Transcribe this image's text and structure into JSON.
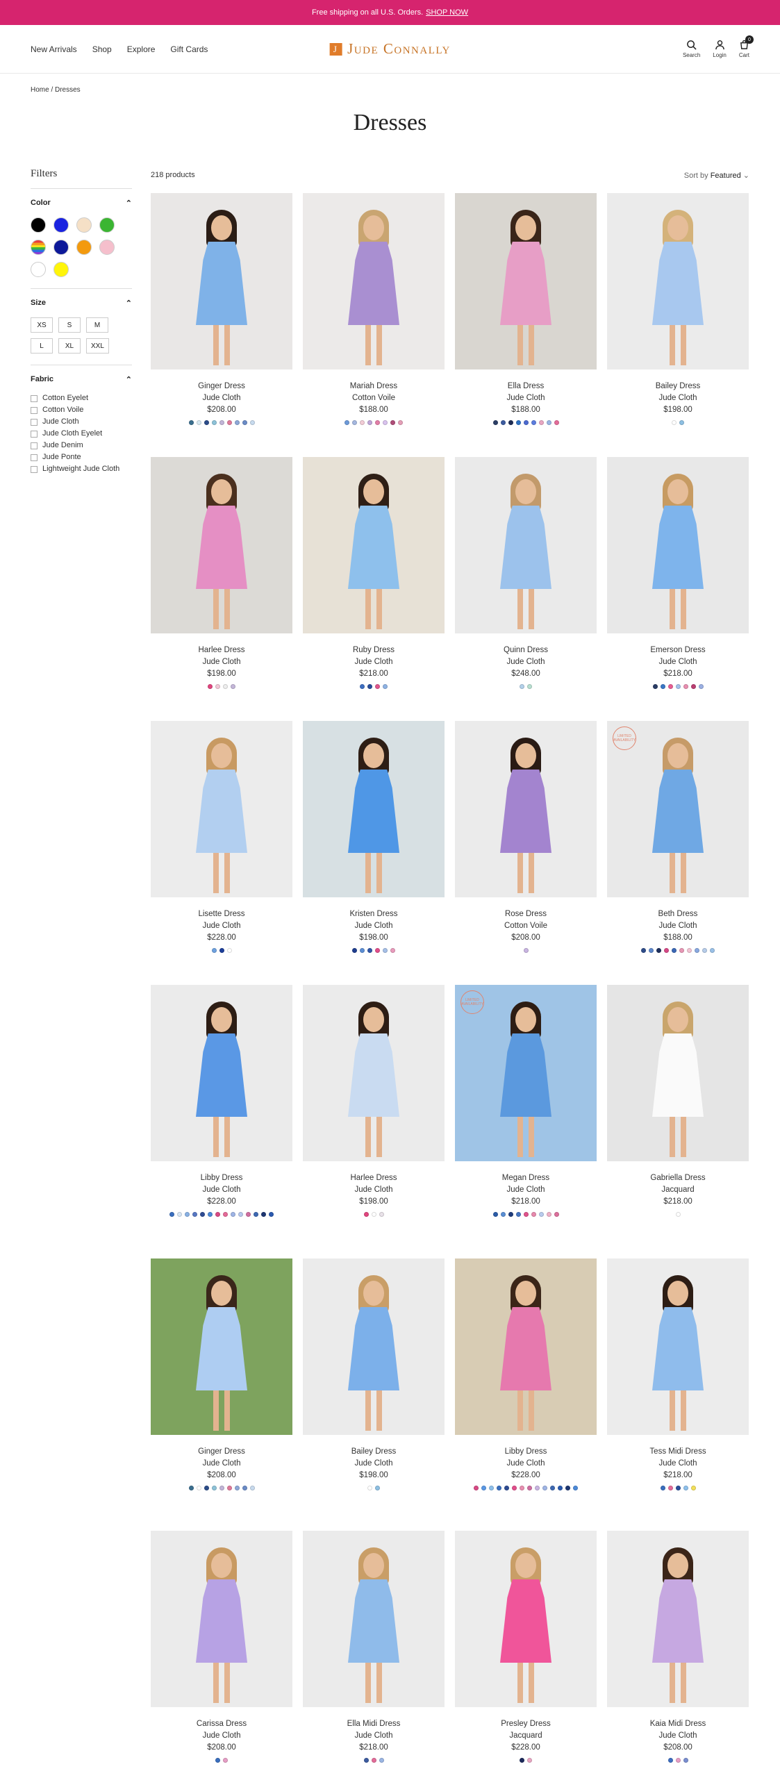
{
  "promo": {
    "text": "Free shipping on all U.S. Orders.",
    "link": "SHOP NOW"
  },
  "nav": [
    "New Arrivals",
    "Shop",
    "Explore",
    "Gift Cards"
  ],
  "logo": "Jude Connally",
  "header_icons": {
    "search": "Search",
    "login": "Login",
    "cart": "Cart",
    "cart_count": "0"
  },
  "breadcrumb": "Home / Dresses",
  "page_title": "Dresses",
  "filters": {
    "title": "Filters",
    "color_label": "Color",
    "colors": [
      "#000000",
      "#1a23e0",
      "#f5e0c6",
      "#3bb532",
      "rainbow",
      "#0d1999",
      "#f39a0e",
      "#f5bfcc",
      "#ffffff",
      "#fff50a"
    ],
    "size_label": "Size",
    "sizes": [
      "XS",
      "S",
      "M",
      "L",
      "XL",
      "XXL"
    ],
    "fabric_label": "Fabric",
    "fabrics": [
      "Cotton Eyelet",
      "Cotton Voile",
      "Jude Cloth",
      "Jude Cloth Eyelet",
      "Jude Denim",
      "Jude Ponte",
      "Lightweight Jude Cloth"
    ]
  },
  "product_count": "218 products",
  "sort": {
    "label": "Sort by",
    "value": "Featured"
  },
  "products": [
    {
      "name": "Ginger Dress",
      "fabric": "Jude Cloth",
      "price": "$208.00",
      "bg": "#e9e7e6",
      "dress": "#7fb2e8",
      "hair": "#2b1d15",
      "swatches": [
        "#3b6f8f",
        "#d9eaf2",
        "#2c4d8a",
        "#8ec3d9",
        "#c2b5d8",
        "#e07a9a",
        "#8ea8d8",
        "#6b8cc7",
        "#c8dbef"
      ]
    },
    {
      "name": "Mariah Dress",
      "fabric": "Cotton Voile",
      "price": "$188.00",
      "bg": "#eceae9",
      "dress": "#a98fd1",
      "hair": "#c9a571",
      "swatches": [
        "#6d9ad9",
        "#a5b8e0",
        "#f2ccd6",
        "#bfa6d9",
        "#e37fa8",
        "#d9c3ef",
        "#b04e79",
        "#e59fb8"
      ]
    },
    {
      "name": "Ella Dress",
      "fabric": "Jude Cloth",
      "price": "$188.00",
      "bg": "#d9d6d0",
      "dress": "#e79ec6",
      "hair": "#3a2519",
      "swatches": [
        "#2b3f66",
        "#3d5ca0",
        "#1f2d55",
        "#2f72c4",
        "#4c6ad1",
        "#5d7ee0",
        "#e9a7c3",
        "#9bb6e4",
        "#e46d9a"
      ]
    },
    {
      "name": "Bailey Dress",
      "fabric": "Jude Cloth",
      "price": "$198.00",
      "bg": "#ebebeb",
      "dress": "#a8c8ef",
      "hair": "#d4b27a",
      "swatches": [
        "#ffffff",
        "#8ec0e3"
      ]
    },
    {
      "name": "Harlee Dress",
      "fabric": "Jude Cloth",
      "price": "$198.00",
      "bg": "#dcdad6",
      "dress": "#e58fc4",
      "hair": "#4a2f1e",
      "swatches": [
        "#e2467f",
        "#f2c9d8",
        "#eeeeee",
        "#c4b7d9"
      ]
    },
    {
      "name": "Ruby Dress",
      "fabric": "Jude Cloth",
      "price": "$218.00",
      "bg": "#e7e1d6",
      "dress": "#8ec0ec",
      "hair": "#2f1f16",
      "swatches": [
        "#3e6fc2",
        "#2a4f9a",
        "#e1588e",
        "#8fb3e4"
      ]
    },
    {
      "name": "Quinn Dress",
      "fabric": "Jude Cloth",
      "price": "$248.00",
      "bg": "#eaeaea",
      "dress": "#9cc2ec",
      "hair": "#c29a6b",
      "swatches": [
        "#b3d1ea",
        "#b8e0d1"
      ]
    },
    {
      "name": "Emerson Dress",
      "fabric": "Jude Cloth",
      "price": "$218.00",
      "bg": "#e8e8e8",
      "dress": "#7eb4ec",
      "hair": "#c79b62",
      "swatches": [
        "#2a3d66",
        "#3a78c7",
        "#e85e93",
        "#a5c1ea",
        "#e98fb1",
        "#bb3f72",
        "#9bb0e3"
      ]
    },
    {
      "name": "Lisette Dress",
      "fabric": "Jude Cloth",
      "price": "$228.00",
      "bg": "#ececec",
      "dress": "#b2cff0",
      "hair": "#c89a62",
      "swatches": [
        "#6fa2e0",
        "#1d3f9a",
        "#ffffff"
      ]
    },
    {
      "name": "Kristen Dress",
      "fabric": "Jude Cloth",
      "price": "$198.00",
      "bg": "#d7e0e3",
      "dress": "#4f97e6",
      "hair": "#2e1e15",
      "swatches": [
        "#1f3e8f",
        "#5d8fd5",
        "#3158a8",
        "#e24e8b",
        "#a6c0e8",
        "#e99cbd"
      ]
    },
    {
      "name": "Rose Dress",
      "fabric": "Cotton Voile",
      "price": "$208.00",
      "bg": "#ebebeb",
      "dress": "#a384cf",
      "hair": "#2a1b14",
      "swatches": [
        "#c9b5e2"
      ]
    },
    {
      "name": "Beth Dress",
      "fabric": "Jude Cloth",
      "price": "$188.00",
      "bg": "#e9e9e9",
      "dress": "#6fa8e4",
      "hair": "#c69b68",
      "tag": "LIMITED AVAILABILITY",
      "swatches": [
        "#2f4d8a",
        "#5e88cc",
        "#1e305e",
        "#d64986",
        "#3b68b6",
        "#e898b6",
        "#f2c4d4",
        "#89a9e0",
        "#b7cdea",
        "#9ac1e8"
      ]
    },
    {
      "name": "Libby Dress",
      "fabric": "Jude Cloth",
      "price": "$228.00",
      "bg": "#ebebeb",
      "dress": "#5a98e5",
      "hair": "#2d1d14",
      "swatches": [
        "#3a6fbf",
        "#d8e6f4",
        "#89b1e4",
        "#5778c4",
        "#2e4c94",
        "#4c8ad9",
        "#d94a85",
        "#e56a98",
        "#9fb5e6",
        "#b8c9ee",
        "#d06fa1",
        "#3e69b3",
        "#1d3672",
        "#2a5ab0"
      ]
    },
    {
      "name": "Harlee Dress",
      "fabric": "Jude Cloth",
      "price": "$198.00",
      "bg": "#ebebeb",
      "dress": "#c9dbf1",
      "hair": "#2d1d14",
      "swatches": [
        "#e2467f",
        "#ffffff",
        "#e9e2e9"
      ]
    },
    {
      "name": "Megan Dress",
      "fabric": "Jude Cloth",
      "price": "$218.00",
      "bg": "#9fc4e6",
      "dress": "#5b99de",
      "hair": "#2d1d14",
      "tag": "LIMITED AVAILABILITY",
      "swatches": [
        "#2b5ca8",
        "#5a8fd5",
        "#1f3c7c",
        "#4675c2",
        "#e1538c",
        "#e889ad",
        "#b9ccee",
        "#f0b2c8",
        "#dd6f9c"
      ]
    },
    {
      "name": "Gabriella Dress",
      "fabric": "Jacquard",
      "price": "$218.00",
      "bg": "#e5e5e5",
      "dress": "#fafafa",
      "hair": "#c9a56c",
      "swatches": [
        "#ffffff"
      ]
    },
    {
      "name": "Ginger Dress",
      "fabric": "Jude Cloth",
      "price": "$208.00",
      "bg": "#7ea35e",
      "dress": "#aecdf2",
      "hair": "#3a261a",
      "swatches": [
        "#3b6f8f",
        "#ffffff",
        "#2c4d8a",
        "#8ec3d9",
        "#c2b5d8",
        "#e07a9a",
        "#8ea8d8",
        "#6b8cc7",
        "#c8dbef"
      ]
    },
    {
      "name": "Bailey Dress",
      "fabric": "Jude Cloth",
      "price": "$198.00",
      "bg": "#ebebeb",
      "dress": "#7cb0ea",
      "hair": "#c99e67",
      "swatches": [
        "#ffffff",
        "#8ec0e3"
      ]
    },
    {
      "name": "Libby Dress",
      "fabric": "Jude Cloth",
      "price": "$228.00",
      "bg": "#d8ccb4",
      "dress": "#e679ae",
      "hair": "#3b2518",
      "swatches": [
        "#d94a85",
        "#5a98e5",
        "#8ec0ec",
        "#3a6fbf",
        "#2e4c94",
        "#e24e8b",
        "#e98fb1",
        "#d06fa1",
        "#c9b5e2",
        "#9fb5e6",
        "#3e69b3",
        "#2a5ab0",
        "#1d3672",
        "#4c8ad9"
      ]
    },
    {
      "name": "Tess Midi Dress",
      "fabric": "Jude Cloth",
      "price": "$218.00",
      "bg": "#ececec",
      "dress": "#8fbcec",
      "hair": "#2d1d14",
      "swatches": [
        "#3a6fbf",
        "#e46d9a",
        "#2a4f9a",
        "#8ec0ec",
        "#f3e05a"
      ]
    },
    {
      "name": "Carissa Dress",
      "fabric": "Jude Cloth",
      "price": "$208.00",
      "bg": "#ebebeb",
      "dress": "#b7a2e4",
      "hair": "#c89a62",
      "swatches": [
        "#3a6fbf",
        "#e79ec6"
      ]
    },
    {
      "name": "Ella Midi Dress",
      "fabric": "Jude Cloth",
      "price": "$218.00",
      "bg": "#ebebeb",
      "dress": "#8fbbea",
      "hair": "#c99e67",
      "swatches": [
        "#3d5ca0",
        "#e46d9a",
        "#9bb6e4"
      ]
    },
    {
      "name": "Presley Dress",
      "fabric": "Jacquard",
      "price": "$228.00",
      "bg": "#ececec",
      "dress": "#f0559a",
      "hair": "#c99e67",
      "swatches": [
        "#1d2a5c",
        "#e9a7c3"
      ]
    },
    {
      "name": "Kaia Midi Dress",
      "fabric": "Jude Cloth",
      "price": "$208.00",
      "bg": "#ececec",
      "dress": "#c6a8e1",
      "hair": "#3b2518",
      "swatches": [
        "#3e6fc2",
        "#e79ec6",
        "#7a8fd1"
      ]
    }
  ]
}
